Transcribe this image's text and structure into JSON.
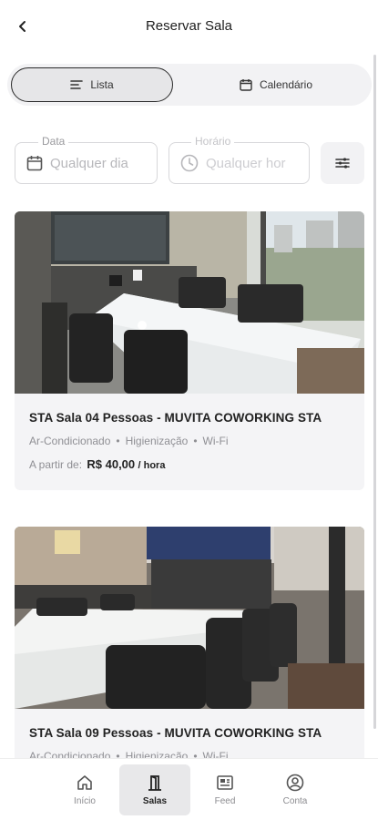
{
  "header": {
    "title": "Reservar Sala",
    "back_icon": "chevron-left-icon"
  },
  "view_toggle": {
    "list_label": "Lista",
    "calendar_label": "Calendário",
    "selected": "Lista"
  },
  "filters": {
    "date_label": "Data",
    "date_value": "Qualquer dia",
    "time_label": "Horário",
    "time_value": "Qualquer hor"
  },
  "rooms": [
    {
      "title": "STA Sala 04 Pessoas - MUVITA COWORKING STA",
      "amenities": [
        "Ar-Condicionado",
        "Higienização",
        "Wi-Fi"
      ],
      "price_prefix": "A partir de:",
      "price": "R$ 40,00",
      "price_unit": "/ hora"
    },
    {
      "title": "STA Sala 09 Pessoas - MUVITA COWORKING STA",
      "amenities": [
        "Ar-Condicionado",
        "Higienização",
        "Wi-Fi"
      ]
    }
  ],
  "bottom_nav": {
    "items": [
      {
        "label": "Início",
        "icon": "home-icon"
      },
      {
        "label": "Salas",
        "icon": "door-icon"
      },
      {
        "label": "Feed",
        "icon": "newspaper-icon"
      },
      {
        "label": "Conta",
        "icon": "user-circle-icon"
      }
    ],
    "active": "Salas"
  },
  "colors": {
    "accent": "#2a2a2a",
    "muted": "#8f8f94",
    "card_bg": "#f4f4f6"
  }
}
